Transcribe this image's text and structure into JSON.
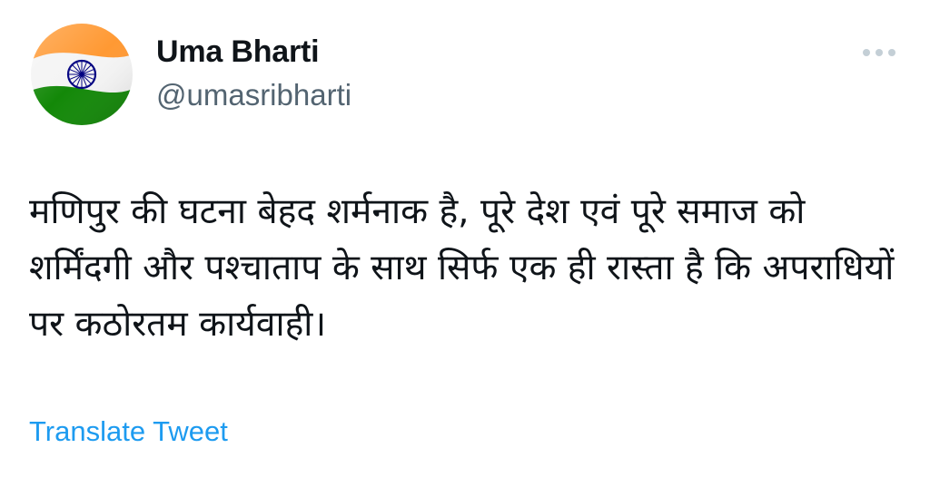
{
  "author": {
    "name": "Uma Bharti",
    "handle": "@umasribharti",
    "avatar_icon": "indian-flag-icon"
  },
  "menu": {
    "icon": "more-options-icon"
  },
  "tweet": {
    "text": "मणिपुर की घटना बेहद शर्मनाक है, पूरे देश एवं पूरे समाज को शर्मिंदगी और पश्चाताप के साथ सिर्फ एक ही रास्ता है कि अपराधियों पर कठोरतम कार्यवाही।"
  },
  "actions": {
    "translate_label": "Translate Tweet"
  },
  "colors": {
    "primary_text": "#0f1419",
    "secondary_text": "#536471",
    "link": "#1d9bf0",
    "saffron": "#ff9933",
    "green": "#138808",
    "chakra": "#000080"
  }
}
